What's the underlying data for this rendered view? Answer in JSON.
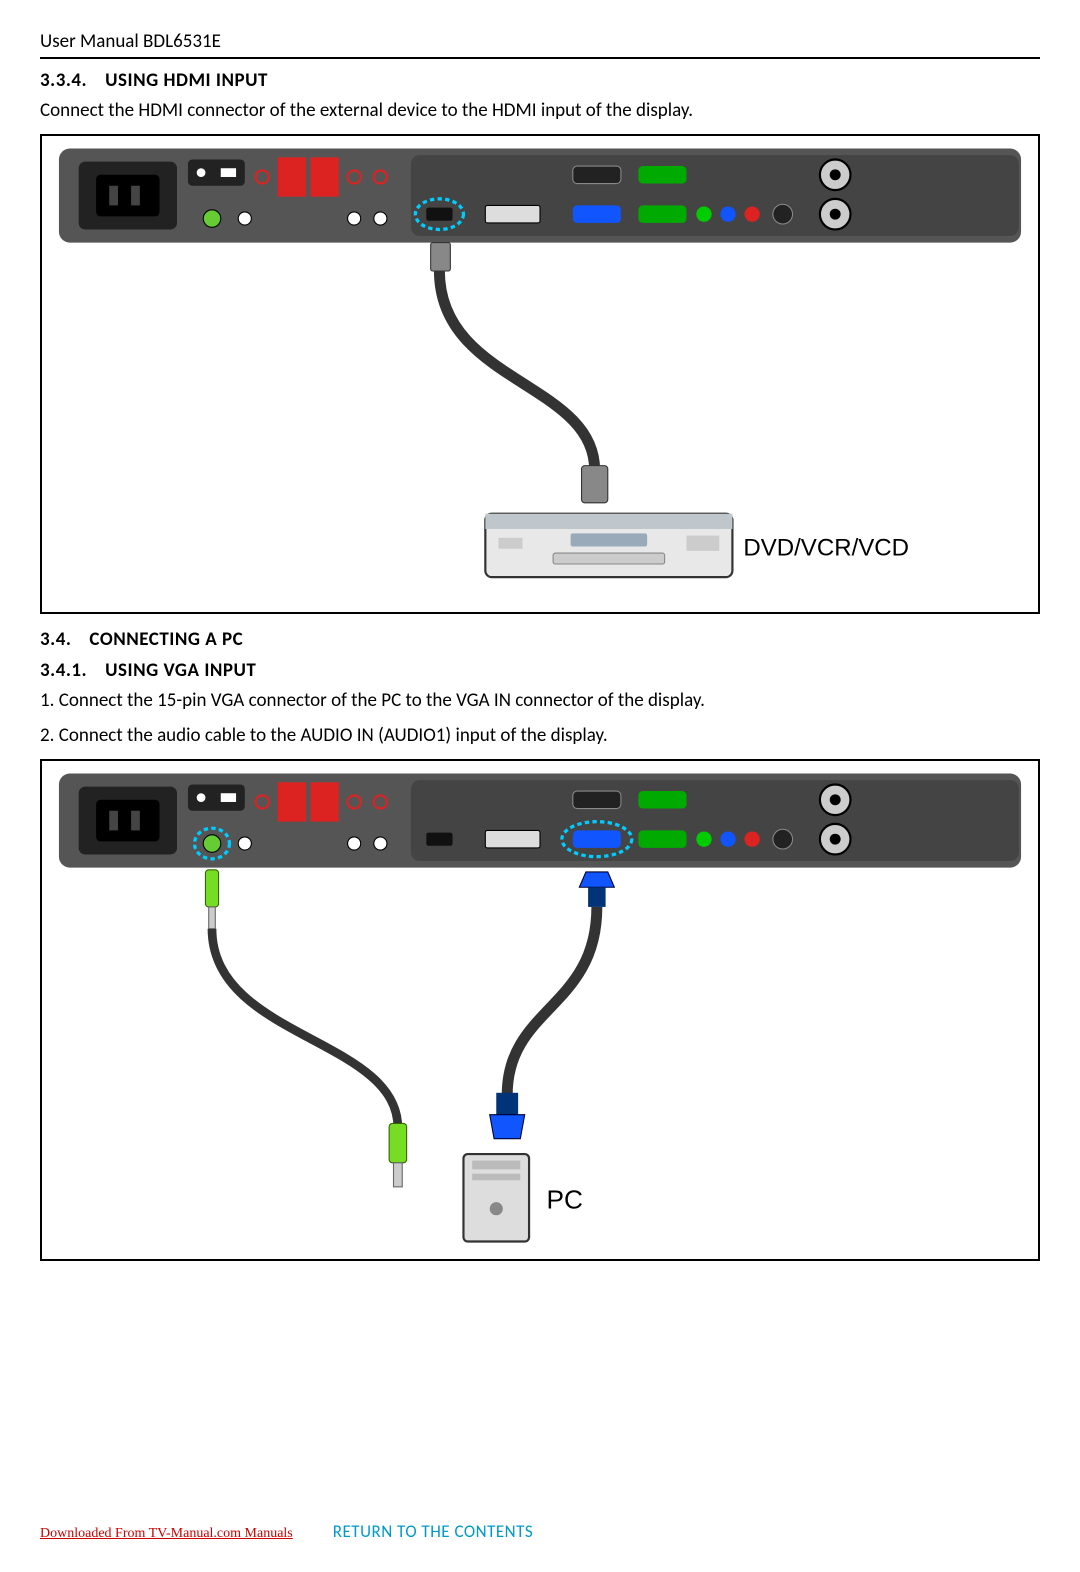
{
  "header": "User Manual BDL6531E",
  "s1": {
    "num": "3.3.4.",
    "title": "USING HDMI INPUT"
  },
  "s1_body": "Connect the HDMI connector of the external device to the HDMI input of the display.",
  "diagram1": {
    "device_label": "DVD/VCR/VCD"
  },
  "s2": {
    "num": "3.4.",
    "title": "CONNECTING A PC"
  },
  "s3": {
    "num": "3.4.1.",
    "title": "USING VGA INPUT"
  },
  "s3_step1": "1. Connect the 15-pin VGA connector of the PC to the VGA IN connector of the display.",
  "s3_step2": "2. Connect the audio cable to the AUDIO IN (AUDIO1) input of the display.",
  "diagram2": {
    "device_label": "PC"
  },
  "footer": {
    "download": "Downloaded From TV-Manual.com Manuals",
    "return": "RETURN TO THE CONTENTS"
  }
}
